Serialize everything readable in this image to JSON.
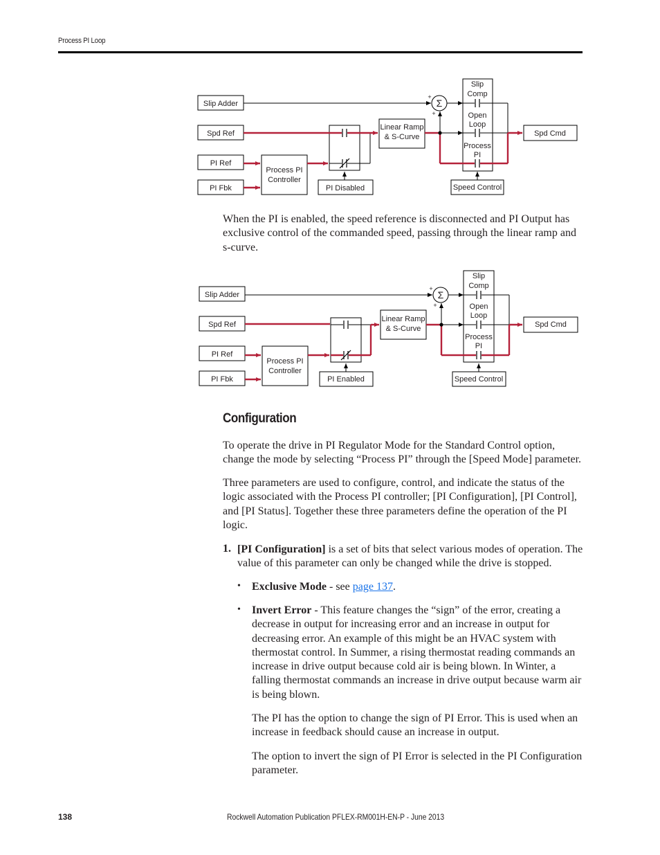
{
  "header": {
    "section_title": "Process PI Loop"
  },
  "diagram1": {
    "slip_adder": "Slip Adder",
    "spd_ref": "Spd Ref",
    "pi_ref": "PI Ref",
    "pi_fbk": "PI Fbk",
    "controller_line1": "Process PI",
    "controller_line2": "Controller",
    "switch_label": "PI Disabled",
    "ramp_line1": "Linear Ramp",
    "ramp_line2": "& S-Curve",
    "sum_symbol": "Σ",
    "plus": "+",
    "mode_slip_1": "Slip",
    "mode_slip_2": "Comp",
    "mode_open_1": "Open",
    "mode_open_2": "Loop",
    "mode_pi_1": "Process",
    "mode_pi_2": "PI",
    "speed_control": "Speed Control",
    "spd_cmd": "Spd Cmd"
  },
  "middle_paragraph": "When the PI is enabled, the speed reference is disconnected and PI Output has exclusive control of the commanded speed, passing through the linear ramp and s-curve.",
  "diagram2": {
    "slip_adder": "Slip Adder",
    "spd_ref": "Spd Ref",
    "pi_ref": "PI Ref",
    "pi_fbk": "PI Fbk",
    "controller_line1": "Process PI",
    "controller_line2": "Controller",
    "switch_label": "PI Enabled",
    "ramp_line1": "Linear Ramp",
    "ramp_line2": "& S-Curve",
    "sum_symbol": "Σ",
    "plus": "+",
    "mode_slip_1": "Slip",
    "mode_slip_2": "Comp",
    "mode_open_1": "Open",
    "mode_open_2": "Loop",
    "mode_pi_1": "Process",
    "mode_pi_2": "PI",
    "speed_control": "Speed Control",
    "spd_cmd": "Spd Cmd"
  },
  "section": {
    "heading": "Configuration",
    "para1": "To operate the drive in PI Regulator Mode for the Standard Control option, change the mode by selecting “Process PI” through the [Speed Mode] parameter.",
    "para2": "Three parameters are used to configure, control, and indicate the status of the logic associated with the Process PI controller; [PI Configuration], [PI Control], and [PI Status]. Together these three parameters define the operation of the PI logic.",
    "item1_number": "1.",
    "item1_bold": "[PI Configuration]",
    "item1_text": " is a set of bits that select various modes of operation. The value of this parameter can only be changed while the drive is stopped.",
    "bullet_symbol": "•",
    "bullet1_bold": "Exclusive Mode",
    "bullet1_text": " - see ",
    "bullet1_link": "page 137",
    "bullet1_end": ".",
    "bullet2_bold": "Invert Error",
    "bullet2_text": " - This feature changes the “sign” of the error, creating a decrease in output for increasing error and an increase in output for decreasing error. An example of this might be an HVAC system with thermostat control. In Summer, a rising thermostat reading commands an increase in drive output because cold air is being blown. In Winter, a falling thermostat commands an increase in drive output because warm air is being blown.",
    "sub_para1": "The PI has the option to change the sign of PI Error. This is used when an increase in feedback should cause an increase in output.",
    "sub_para2": "The option to invert the sign of PI Error is selected in the PI Configuration parameter."
  },
  "footer": {
    "page_number": "138",
    "publication": "Rockwell Automation Publication PFLEX-RM001H-EN-P - June 2013"
  },
  "colors": {
    "signal_active": "#b5223a",
    "text": "#231f20",
    "link": "#1a73e8"
  }
}
